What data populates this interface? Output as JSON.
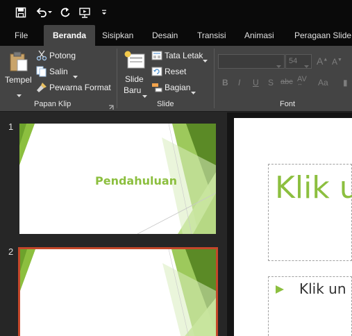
{
  "qat": {
    "icons": [
      "save-icon",
      "undo-icon",
      "redo-icon",
      "start-from-beginning-icon",
      "customize-qat-icon"
    ]
  },
  "tabs": [
    {
      "label": "File"
    },
    {
      "label": "Beranda"
    },
    {
      "label": "Sisipkan"
    },
    {
      "label": "Desain"
    },
    {
      "label": "Transisi"
    },
    {
      "label": "Animasi"
    },
    {
      "label": "Peragaan Slide"
    }
  ],
  "ribbon": {
    "clipboard": {
      "paste": "Tempel",
      "cut": "Potong",
      "copy": "Salin",
      "format_painter": "Pewarna Format",
      "group_label": "Papan Klip"
    },
    "slides": {
      "new_slide_1": "Slide",
      "new_slide_2": "Baru",
      "layout": "Tata Letak",
      "reset": "Reset",
      "section": "Bagian",
      "group_label": "Slide"
    },
    "font": {
      "size": "54",
      "group_label": "Font"
    }
  },
  "slides": [
    {
      "number": "1",
      "title": "Pendahuluan"
    },
    {
      "number": "2",
      "title": ""
    }
  ],
  "editor": {
    "title_text": "Klik u",
    "bullet_text": "Klik un"
  },
  "colors": {
    "accent_green": "#8cbf3f",
    "selection_orange": "#c4472a",
    "ribbon_bg": "#444444",
    "tab_bar_bg": "#0a0a0a"
  }
}
